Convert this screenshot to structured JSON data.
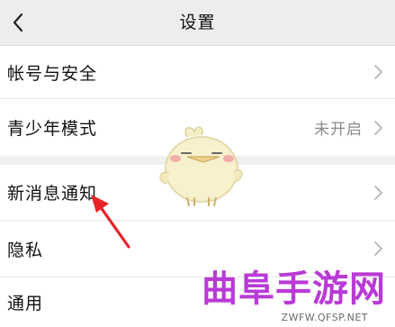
{
  "header": {
    "title": "设置",
    "back_icon": "chevron-left-icon"
  },
  "settings": {
    "account_security": {
      "label": "帐号与安全"
    },
    "youth_mode": {
      "label": "青少年模式",
      "value": "未开启"
    },
    "new_message_notification": {
      "label": "新消息通知"
    },
    "privacy": {
      "label": "隐私"
    },
    "general": {
      "label": "通用"
    }
  },
  "overlay": {
    "mascot": "chick-mascot-icon",
    "arrow": "red-arrow-icon",
    "arrow_color": "#e8232a"
  },
  "watermark": {
    "title": "曲阜手游网",
    "url": "ZWFW.QFSP.NET",
    "color": "#b93ad6"
  }
}
